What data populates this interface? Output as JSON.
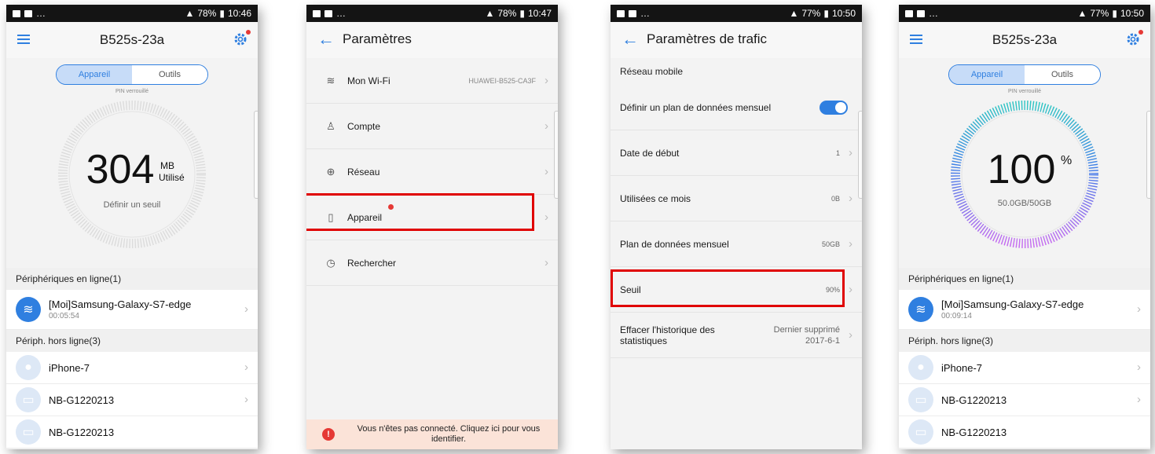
{
  "screens": [
    {
      "status": {
        "battery": "78%",
        "time": "10:46"
      },
      "title": "B525s-23a",
      "tabs": {
        "device": "Appareil",
        "tools": "Outils"
      },
      "pin": "PIN verrouillé",
      "gauge": {
        "value": "304",
        "unit": "MB",
        "unit_sub": "Utilisé",
        "sub": "Définir un seuil"
      },
      "online_header": "Périphériques en ligne(1)",
      "online_device": {
        "name": "[Moi]Samsung-Galaxy-S7-edge",
        "time": "00:05:54"
      },
      "offline_header": "Périph. hors ligne(3)",
      "offline_devices": [
        "iPhone-7",
        "NB-G1220213",
        "NB-G1220213"
      ]
    },
    {
      "status": {
        "battery": "78%",
        "time": "10:47"
      },
      "title": "Paramètres",
      "items": [
        {
          "label": "Mon Wi-Fi",
          "value": "HUAWEI-B525-CA3F",
          "icon": "wifi-icon"
        },
        {
          "label": "Compte",
          "value": "",
          "icon": "user-icon"
        },
        {
          "label": "Réseau",
          "value": "",
          "icon": "globe-icon"
        },
        {
          "label": "Appareil",
          "value": "",
          "icon": "device-icon"
        },
        {
          "label": "Rechercher",
          "value": "",
          "icon": "clock-icon"
        }
      ],
      "banner": "Vous n'êtes pas connecté. Cliquez ici pour vous identifier."
    },
    {
      "status": {
        "battery": "77%",
        "time": "10:50"
      },
      "title": "Paramètres de trafic",
      "section": "Réseau mobile",
      "rows": [
        {
          "label": "Définir un plan de données mensuel",
          "value": ""
        },
        {
          "label": "Date de début",
          "value": "1"
        },
        {
          "label": "Utilisées ce mois",
          "value": "0B"
        },
        {
          "label": "Plan de données mensuel",
          "value": "50GB"
        },
        {
          "label": "Seuil",
          "value": "90%"
        },
        {
          "label": "Effacer l'historique des statistiques",
          "value": "Dernier supprimé 2017-6-1"
        }
      ]
    },
    {
      "status": {
        "battery": "77%",
        "time": "10:50"
      },
      "title": "B525s-23a",
      "tabs": {
        "device": "Appareil",
        "tools": "Outils"
      },
      "pin": "PIN verrouillé",
      "gauge": {
        "value": "100",
        "unit": "%",
        "sub": "50.0GB/50GB"
      },
      "online_header": "Périphériques en ligne(1)",
      "online_device": {
        "name": "[Moi]Samsung-Galaxy-S7-edge",
        "time": "00:09:14"
      },
      "offline_header": "Périph. hors ligne(3)",
      "offline_devices": [
        "iPhone-7",
        "NB-G1220213",
        "NB-G1220213"
      ]
    }
  ],
  "colors": {
    "accent": "#2f7fe0",
    "highlight": "#e00000",
    "banner_bg": "#fbe3d8"
  }
}
